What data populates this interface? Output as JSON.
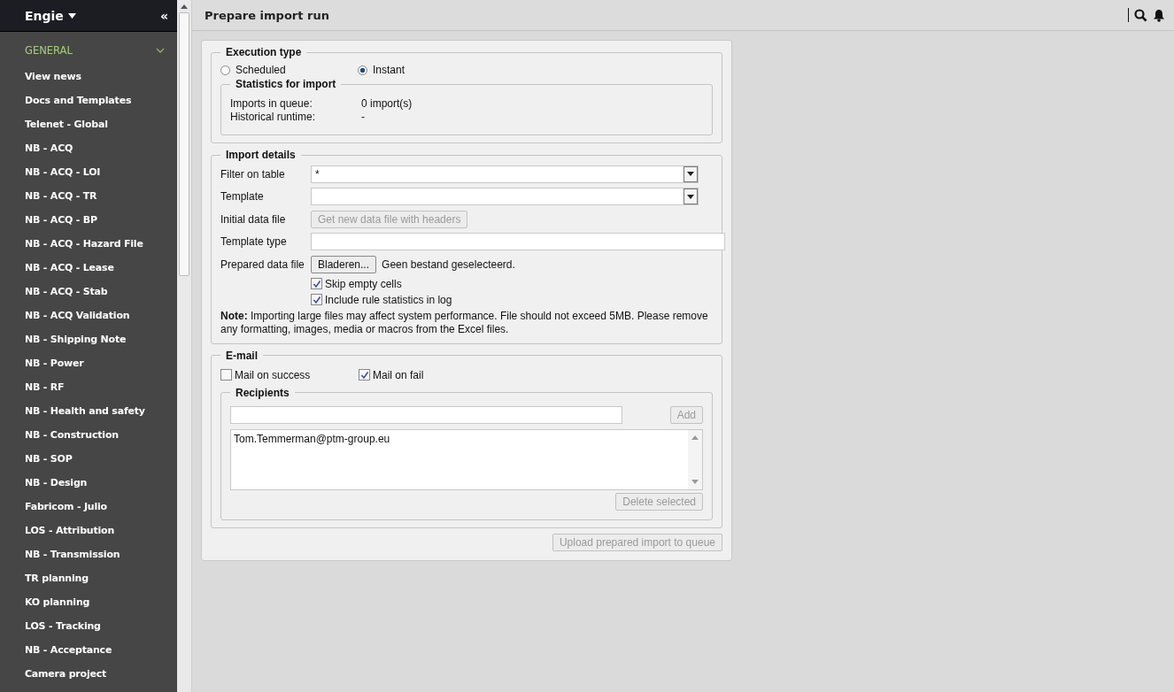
{
  "sidebar": {
    "brand": "Engie",
    "collapse": "«",
    "section": {
      "label": "GENERAL",
      "expanded": true
    },
    "items": [
      "View news",
      "Docs and Templates",
      "Telenet - Global",
      "NB - ACQ",
      "NB - ACQ - LOI",
      "NB - ACQ - TR",
      "NB - ACQ - BP",
      "NB - ACQ - Hazard File",
      "NB - ACQ - Lease",
      "NB - ACQ - Stab",
      "NB - ACQ Validation",
      "NB - Shipping Note",
      "NB - Power",
      "NB - RF",
      "NB - Health and safety",
      "NB - Construction",
      "NB - SOP",
      "NB - Design",
      "Fabricom - Julio",
      "LOS - Attribution",
      "NB - Transmission",
      "TR planning",
      "KO planning",
      "LOS - Tracking",
      "NB - Acceptance",
      "Camera project"
    ]
  },
  "header": {
    "title": "Prepare import run"
  },
  "execution": {
    "legend": "Execution type",
    "options": [
      {
        "label": "Scheduled",
        "selected": false
      },
      {
        "label": "Instant",
        "selected": true
      }
    ],
    "stats": {
      "legend": "Statistics for import",
      "rows": [
        {
          "label": "Imports in queue:",
          "value": "0 import(s)"
        },
        {
          "label": "Historical runtime:",
          "value": "-"
        }
      ]
    }
  },
  "import_details": {
    "legend": "Import details",
    "filter_label": "Filter on table",
    "filter_value": "*",
    "template_label": "Template",
    "initial_label": "Initial data file",
    "initial_button": {
      "label": "Get new data file with headers",
      "disabled": true
    },
    "template_type_label": "Template type",
    "prepared_label": "Prepared data file",
    "browse_button": "Bladeren...",
    "file_status": "Geen bestand geselecteerd.",
    "checkboxes": [
      {
        "label": "Skip empty cells",
        "checked": true
      },
      {
        "label": "Include rule statistics in log",
        "checked": true
      }
    ],
    "note": "**Note:** Importing large files may affect system performance. File should not exceed 5MB. Please remove any formatting, images, media or macros from the Excel files."
  },
  "email": {
    "legend": "E-mail",
    "checkboxes": [
      {
        "label": "Mail on success",
        "checked": false
      },
      {
        "label": "Mail on fail",
        "checked": true
      }
    ],
    "recipients": {
      "legend": "Recipients",
      "add_button": {
        "label": "Add",
        "disabled": true
      },
      "list": [
        "Tom.Temmerman@ptm-group.eu"
      ],
      "delete_button": {
        "label": "Delete selected",
        "disabled": true
      }
    }
  },
  "upload_button": {
    "label": "Upload prepared import to queue",
    "disabled": true
  }
}
